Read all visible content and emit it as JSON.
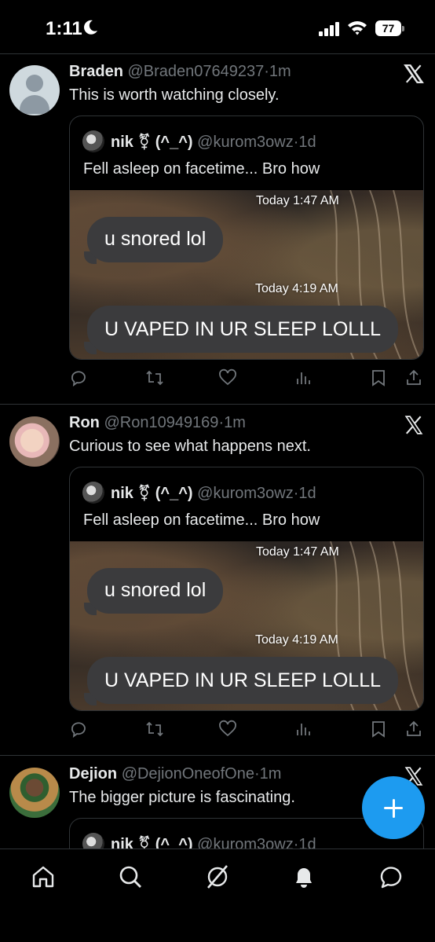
{
  "status_bar": {
    "time": "1:11",
    "battery": "77"
  },
  "posts": [
    {
      "name": "Braden",
      "handle": "@Braden07649237",
      "sep": "·",
      "time": "1m",
      "text": "This is worth watching closely.",
      "quote": {
        "name": "nik ⚧ (^_^)",
        "handle": "@kurom3owz",
        "sep": "·",
        "time": "1d",
        "text": "Fell asleep on facetime... Bro how",
        "media": {
          "timestamp_1": "Today 1:47 AM",
          "message_1": "u snored lol",
          "timestamp_2": "Today 4:19 AM",
          "message_2": "U VAPED IN UR SLEEP LOLLL"
        }
      }
    },
    {
      "name": "Ron",
      "handle": "@Ron10949169",
      "sep": "·",
      "time": "1m",
      "text": "Curious to see what happens next.",
      "quote": {
        "name": "nik ⚧ (^_^)",
        "handle": "@kurom3owz",
        "sep": "·",
        "time": "1d",
        "text": "Fell asleep on facetime... Bro how",
        "media": {
          "timestamp_1": "Today 1:47 AM",
          "message_1": "u snored lol",
          "timestamp_2": "Today 4:19 AM",
          "message_2": "U VAPED IN UR SLEEP LOLLL"
        }
      }
    },
    {
      "name": "Dejion",
      "handle": "@DejionOneofOne",
      "sep": "·",
      "time": "1m",
      "text": "The bigger picture is fascinating.",
      "quote": {
        "name": "nik ⚧ (^_^)",
        "handle": "@kurom3owz",
        "sep": "·",
        "time": "1d"
      }
    }
  ],
  "icons": {
    "action_bar": [
      "reply-icon",
      "repost-icon",
      "like-icon",
      "views-icon",
      "bookmark-icon",
      "share-icon"
    ],
    "tab_bar": [
      "home-icon",
      "search-icon",
      "grok-icon",
      "notifications-icon",
      "messages-icon"
    ],
    "fab": "compose-plus-icon"
  },
  "colors": {
    "accent": "#1d9bf0",
    "text": "#e7e9ea",
    "muted": "#71767b",
    "border": "#2f3336",
    "bubble": "#3b3b3d"
  }
}
